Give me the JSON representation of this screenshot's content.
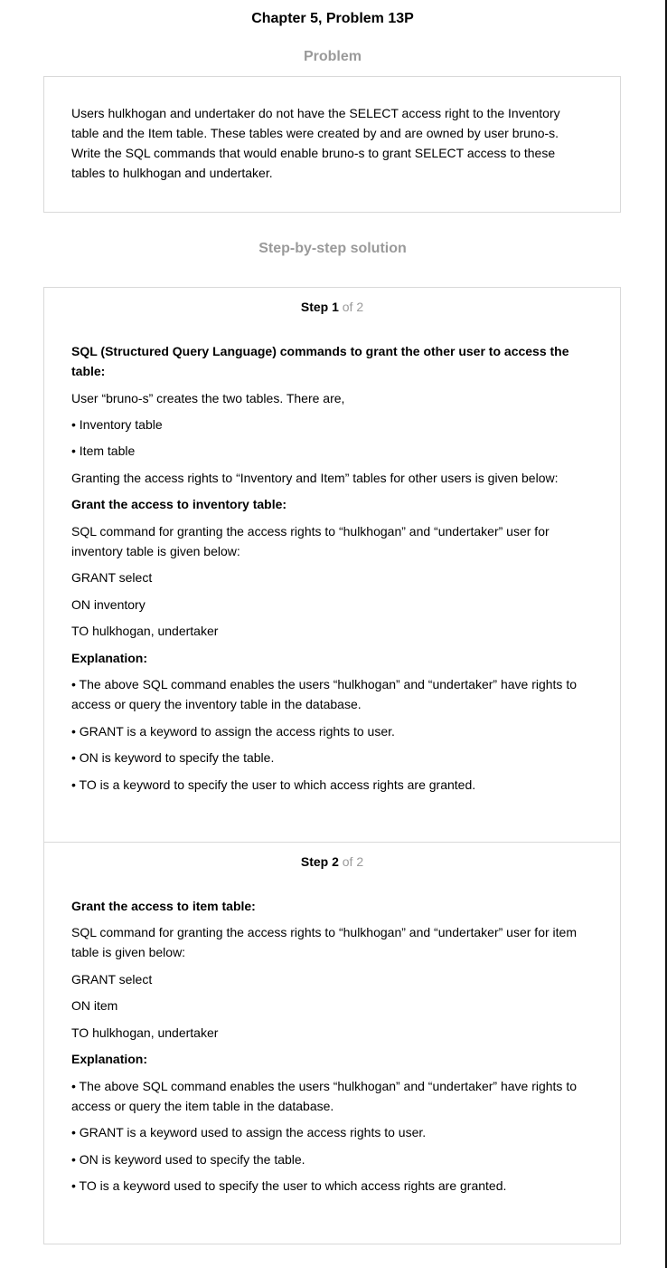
{
  "title": "Chapter 5, Problem 13P",
  "problem": {
    "heading": "Problem",
    "text": "Users hulkhogan and undertaker do not have the SELECT access right to the Inventory table and the Item table. These tables were created by and are owned by user bruno-s. Write the SQL commands that would enable bruno-s to grant SELECT access to these tables to hulkhogan and undertaker."
  },
  "solution": {
    "heading": "Step-by-step solution",
    "steps": [
      {
        "label": "Step 1",
        "of": "of 2",
        "lines": [
          "SQL (Structured Query Language) commands to grant the other user to access the table:",
          "User “bruno-s” creates the two tables. There are,",
          "• Inventory table",
          "• Item table",
          "Granting the access rights to “Inventory and Item” tables for other users is given below:",
          "Grant the access to inventory table:",
          "SQL command for granting the access rights to “hulkhogan” and “undertaker” user for inventory table is given below:",
          "GRANT select",
          "ON inventory",
          "TO hulkhogan, undertaker",
          "Explanation:",
          "• The above SQL command enables the users “hulkhogan” and “undertaker” have rights to access or query the inventory table in the database.",
          "• GRANT is a keyword to assign the access rights to user.",
          "• ON is keyword to specify the table.",
          "• TO is a keyword to specify the user to which access rights are granted."
        ]
      },
      {
        "label": "Step 2",
        "of": "of 2",
        "lines": [
          "Grant the access to item table:",
          "SQL command for granting the access rights to “hulkhogan” and “undertaker” user for item table is given below:",
          "GRANT select",
          "ON item",
          "TO hulkhogan, undertaker",
          "Explanation:",
          "• The above SQL command enables the users “hulkhogan” and “undertaker” have rights to access or query the item table in the database.",
          "• GRANT is a keyword used to assign the access rights to user.",
          "• ON is keyword used to specify the table.",
          "• TO is a keyword used to specify the user to which access rights are granted."
        ]
      }
    ]
  }
}
